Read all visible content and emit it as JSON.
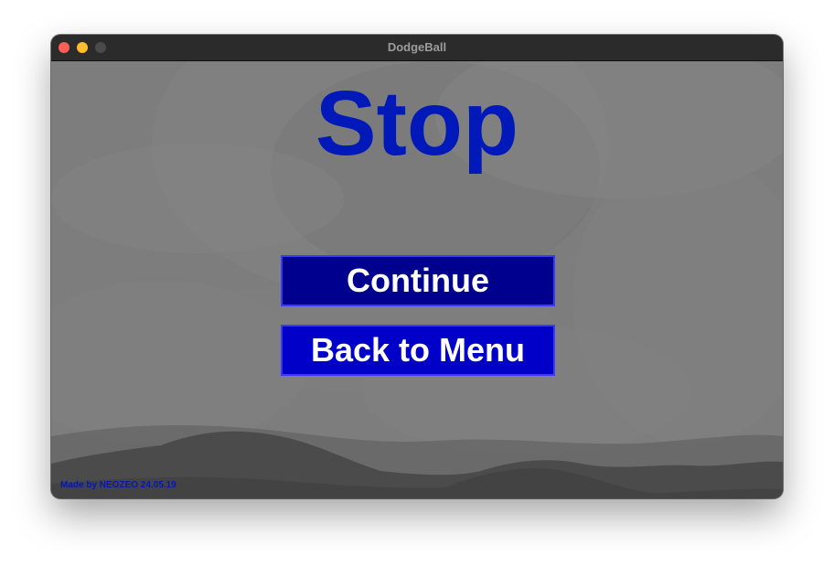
{
  "window": {
    "title": "DodgeBall",
    "controls": [
      {
        "name": "close",
        "color": "#ff5f57"
      },
      {
        "name": "minimize",
        "color": "#febc2e"
      },
      {
        "name": "zoom",
        "color": "#4a4a4a"
      }
    ]
  },
  "game": {
    "pause_title": "Stop",
    "buttons": {
      "continue_label": "Continue",
      "back_to_menu_label": "Back to Menu"
    },
    "credit": "Made by NEOZEO 24.05.19"
  },
  "colors": {
    "title_text": "#0019b8",
    "continue_bg": "#00008f",
    "back_bg": "#0000c8",
    "credit_text": "#0019b8",
    "background": "#7d7d7d"
  },
  "icons": {
    "close": "close-icon",
    "minimize": "minimize-icon",
    "zoom": "zoom-icon"
  }
}
